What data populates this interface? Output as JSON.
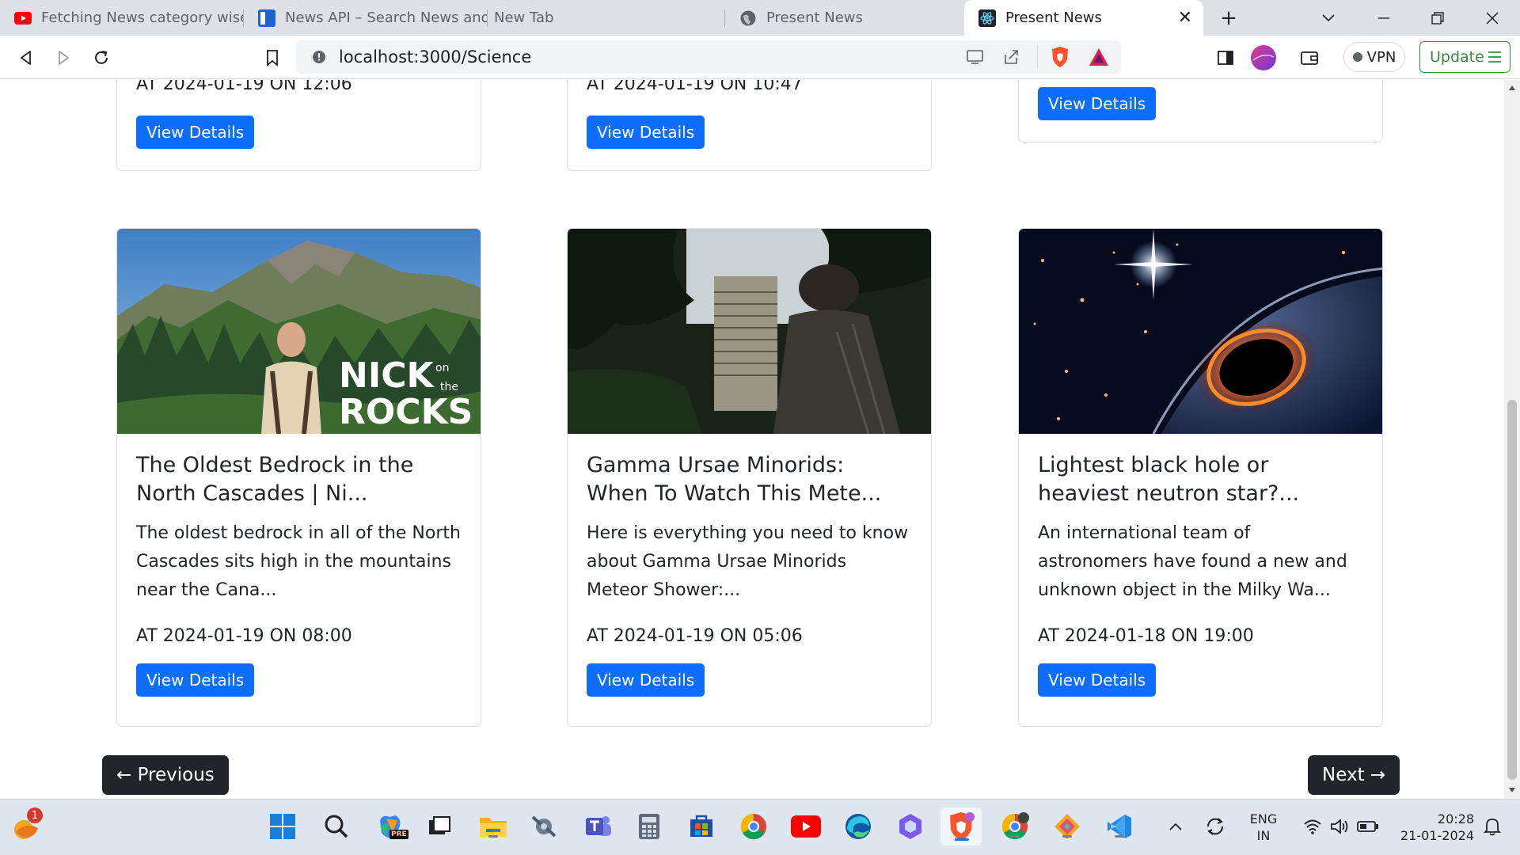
{
  "browser": {
    "tabs": [
      {
        "title": "Fetching News category wise in",
        "icon": "youtube-icon"
      },
      {
        "title": "News API – Search News and B",
        "icon": "newsapi-icon"
      },
      {
        "title": "New Tab",
        "icon": ""
      },
      {
        "title": "Present News",
        "icon": "globe-icon"
      },
      {
        "title": "Present News",
        "icon": "react-icon",
        "active": true
      }
    ],
    "url": "localhost:3000/Science",
    "vpn_label": "VPN",
    "update_label": "Update"
  },
  "news": {
    "top_row": [
      {
        "date": "AT 2024-01-19 ON 12:06",
        "button": "View Details"
      },
      {
        "date": "AT 2024-01-19 ON 10:47",
        "button": "View Details"
      },
      {
        "date": "",
        "button": "View Details"
      }
    ],
    "cards": [
      {
        "title": "The Oldest Bedrock in the North Cascades | Ni...",
        "description": "The oldest bedrock in all of the North Cascades sits high in the mountains near the Cana...",
        "date": "AT 2024-01-19 ON 08:00",
        "button": "View Details",
        "image_logo": {
          "line1": "NICK",
          "on": "on",
          "the": "the",
          "line2": "ROCKS"
        }
      },
      {
        "title": "Gamma Ursae Minorids: When To Watch This Mete...",
        "description": "Here is everything you need to know about Gamma Ursae Minorids Meteor Shower:...",
        "date": "AT 2024-01-19 ON 05:06",
        "button": "View Details"
      },
      {
        "title": "Lightest black hole or heaviest neutron star?...",
        "description": "An international team of astronomers have found a new and unknown object in the Milky Wa...",
        "date": "AT 2024-01-18 ON 19:00",
        "button": "View Details"
      }
    ],
    "pagination": {
      "previous": "← Previous",
      "next": "Next →"
    }
  },
  "taskbar": {
    "widget_badge": "1",
    "lang_line1": "ENG",
    "lang_line2": "IN",
    "time": "20:28",
    "date": "21-01-2024",
    "copilot_badge": "PRE"
  },
  "colors": {
    "primary": "#0d6efd",
    "dark": "#212529",
    "tabstrip": "#dee1e6",
    "taskbar": "#dfe6ef"
  }
}
